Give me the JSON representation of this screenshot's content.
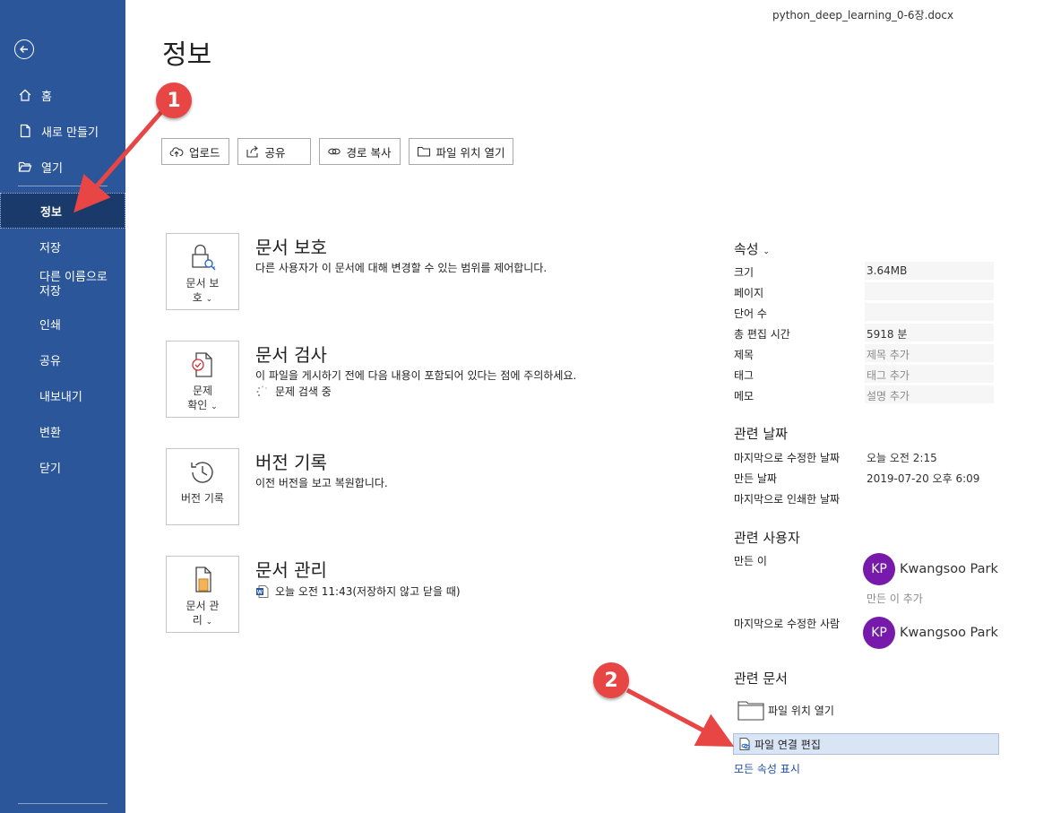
{
  "window": {
    "file_name": "python_deep_learning_0-6장.docx"
  },
  "page_title": "정보",
  "colors": {
    "sidebar": "#2b579a",
    "sidebar_active": "#1a3a6b",
    "avatar": "#7719aa",
    "marker": "#e84545",
    "link": "#1f4e9e"
  },
  "sidebar": {
    "back_icon": "arrow-left-circle-icon",
    "top_items": [
      {
        "label": "홈",
        "icon": "home-icon"
      },
      {
        "label": "새로 만들기",
        "icon": "new-document-icon"
      },
      {
        "label": "열기",
        "icon": "open-folder-icon"
      }
    ],
    "items": [
      {
        "label": "정보",
        "active": true
      },
      {
        "label": "저장"
      },
      {
        "label": "다른 이름으로\n저장"
      },
      {
        "label": "인쇄"
      },
      {
        "label": "공유"
      },
      {
        "label": "내보내기"
      },
      {
        "label": "변환"
      },
      {
        "label": "닫기"
      }
    ]
  },
  "toolbar": {
    "upload": "업로드",
    "share": "공유",
    "copy_path": "경로 복사",
    "open_location": "파일 위치 열기"
  },
  "sections": {
    "protect": {
      "icon_label_1": "문서 보",
      "icon_label_2": "호",
      "title": "문서 보호",
      "desc": "다른 사용자가 이 문서에 대해 변경할 수 있는 범위를 제어합니다."
    },
    "inspect": {
      "icon_label_1": "문제",
      "icon_label_2": "확인",
      "title": "문서 검사",
      "desc": "이 파일을 게시하기 전에 다음 내용이 포함되어 있다는 점에 주의하세요.",
      "status": "문제 검색 중"
    },
    "version": {
      "icon_label": "버전 기록",
      "title": "버전 기록",
      "desc": "이전 버전을 보고 복원합니다."
    },
    "manage": {
      "icon_label_1": "문서 관",
      "icon_label_2": "리",
      "title": "문서 관리",
      "autosave": "오늘 오전 11:43(저장하지 않고 닫을 때)"
    }
  },
  "properties": {
    "header": "속성",
    "size_label": "크기",
    "size_value": "3.64MB",
    "pages_label": "페이지",
    "pages_value": "",
    "words_label": "단어 수",
    "words_value": "",
    "edit_time_label": "총 편집 시간",
    "edit_time_value": "5918 분",
    "title_label": "제목",
    "title_placeholder": "제목 추가",
    "tags_label": "태그",
    "tags_placeholder": "태그 추가",
    "comments_label": "메모",
    "comments_placeholder": "설명 추가"
  },
  "related_dates": {
    "header": "관련 날짜",
    "modified_label": "마지막으로 수정한 날짜",
    "modified_value": "오늘 오전 2:15",
    "created_label": "만든 날짜",
    "created_value": "2019-07-20 오후 6:09",
    "printed_label": "마지막으로 인쇄한 날짜",
    "printed_value": ""
  },
  "related_people": {
    "header": "관련 사용자",
    "author_label": "만든 이",
    "author_initials": "KP",
    "author_name": "Kwangsoo Park",
    "add_author": "만든 이 추가",
    "modified_by_label": "마지막으로 수정한 사람",
    "modified_by_initials": "KP",
    "modified_by_name": "Kwangsoo Park"
  },
  "related_docs": {
    "header": "관련 문서",
    "open_location": "파일 위치 열기",
    "edit_links": "파일 연결 편집",
    "show_all": "모든 속성 표시"
  },
  "markers": {
    "one": "1",
    "two": "2"
  }
}
